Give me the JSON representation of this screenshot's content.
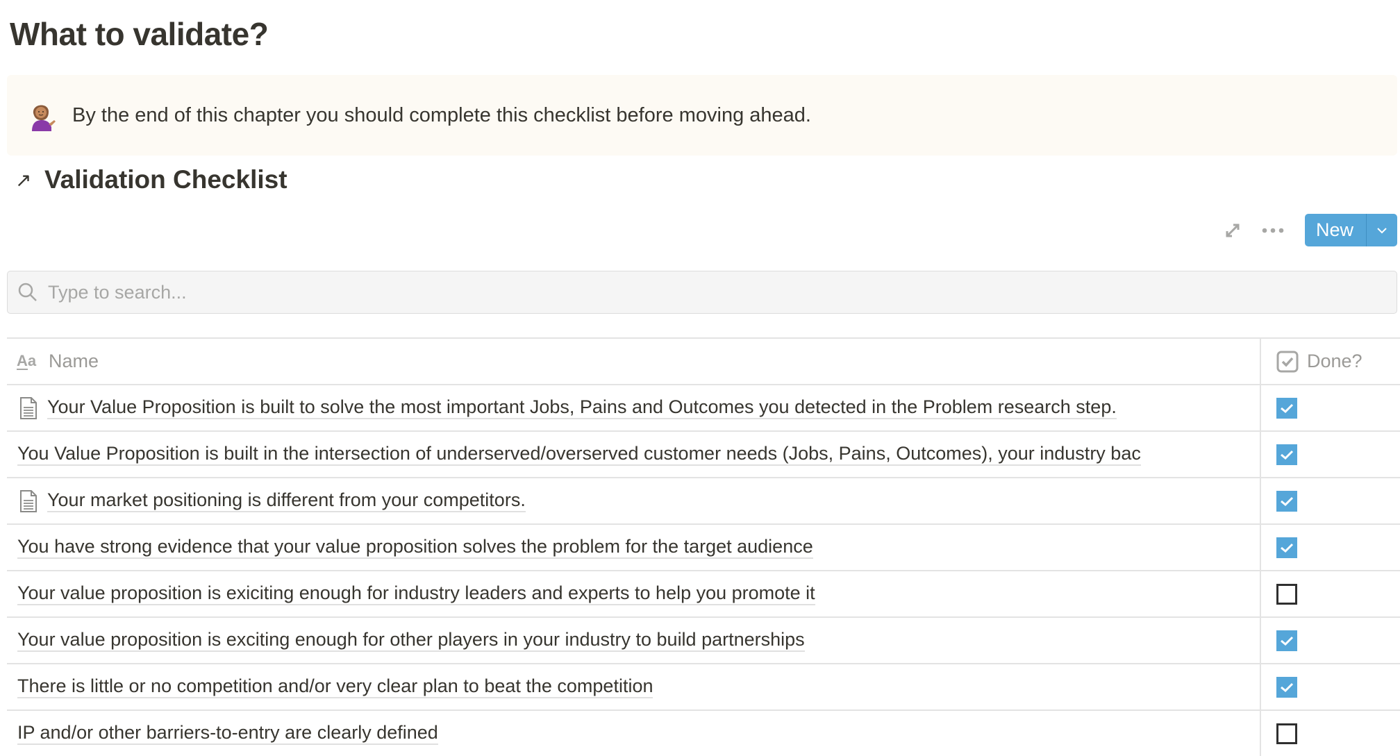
{
  "page": {
    "title": "What to validate?"
  },
  "callout": {
    "icon": "person-tipping-hand-emoji",
    "emoji": "💁🏽‍♀️",
    "text": "By the end of this chapter you should complete this checklist before moving ahead."
  },
  "database": {
    "link_icon": "↗",
    "title": "Validation Checklist",
    "toolbar": {
      "expand_icon": "expand-icon",
      "more_icon": "more-icon",
      "new_label": "New",
      "new_dropdown_icon": "chevron-down-icon"
    },
    "search": {
      "placeholder": "Type to search...",
      "value": ""
    },
    "columns": [
      {
        "icon": "text-property-icon",
        "label": "Name"
      },
      {
        "icon": "checkbox-property-icon",
        "label": "Done?"
      }
    ],
    "rows": [
      {
        "name": "Your Value Proposition is built to solve the most important Jobs, Pains and Outcomes you detected in the Problem research step.",
        "has_page_icon": true,
        "done": true
      },
      {
        "name": "You Value Proposition is built in the intersection of underserved/overserved customer needs (Jobs, Pains, Outcomes), your industry bac",
        "has_page_icon": false,
        "done": true
      },
      {
        "name": "Your market positioning is different from your competitors.",
        "has_page_icon": true,
        "done": true
      },
      {
        "name": "You have strong evidence that your value proposition solves the problem for the target audience",
        "has_page_icon": false,
        "done": true
      },
      {
        "name": "Your value proposition is exiciting enough for industry leaders and experts to help you promote it",
        "has_page_icon": false,
        "done": false
      },
      {
        "name": "Your value proposition is exciting enough for other players in your industry to build partnerships",
        "has_page_icon": false,
        "done": true
      },
      {
        "name": "There is little or no competition and/or very clear plan to beat the competition",
        "has_page_icon": false,
        "done": true
      },
      {
        "name": "IP and/or other barriers-to-entry are clearly defined",
        "has_page_icon": false,
        "done": false
      }
    ]
  },
  "colors": {
    "accent": "#55a6d9",
    "callout_bg": "#fdfaf4",
    "text": "#37352f",
    "muted": "#9b9a97"
  }
}
